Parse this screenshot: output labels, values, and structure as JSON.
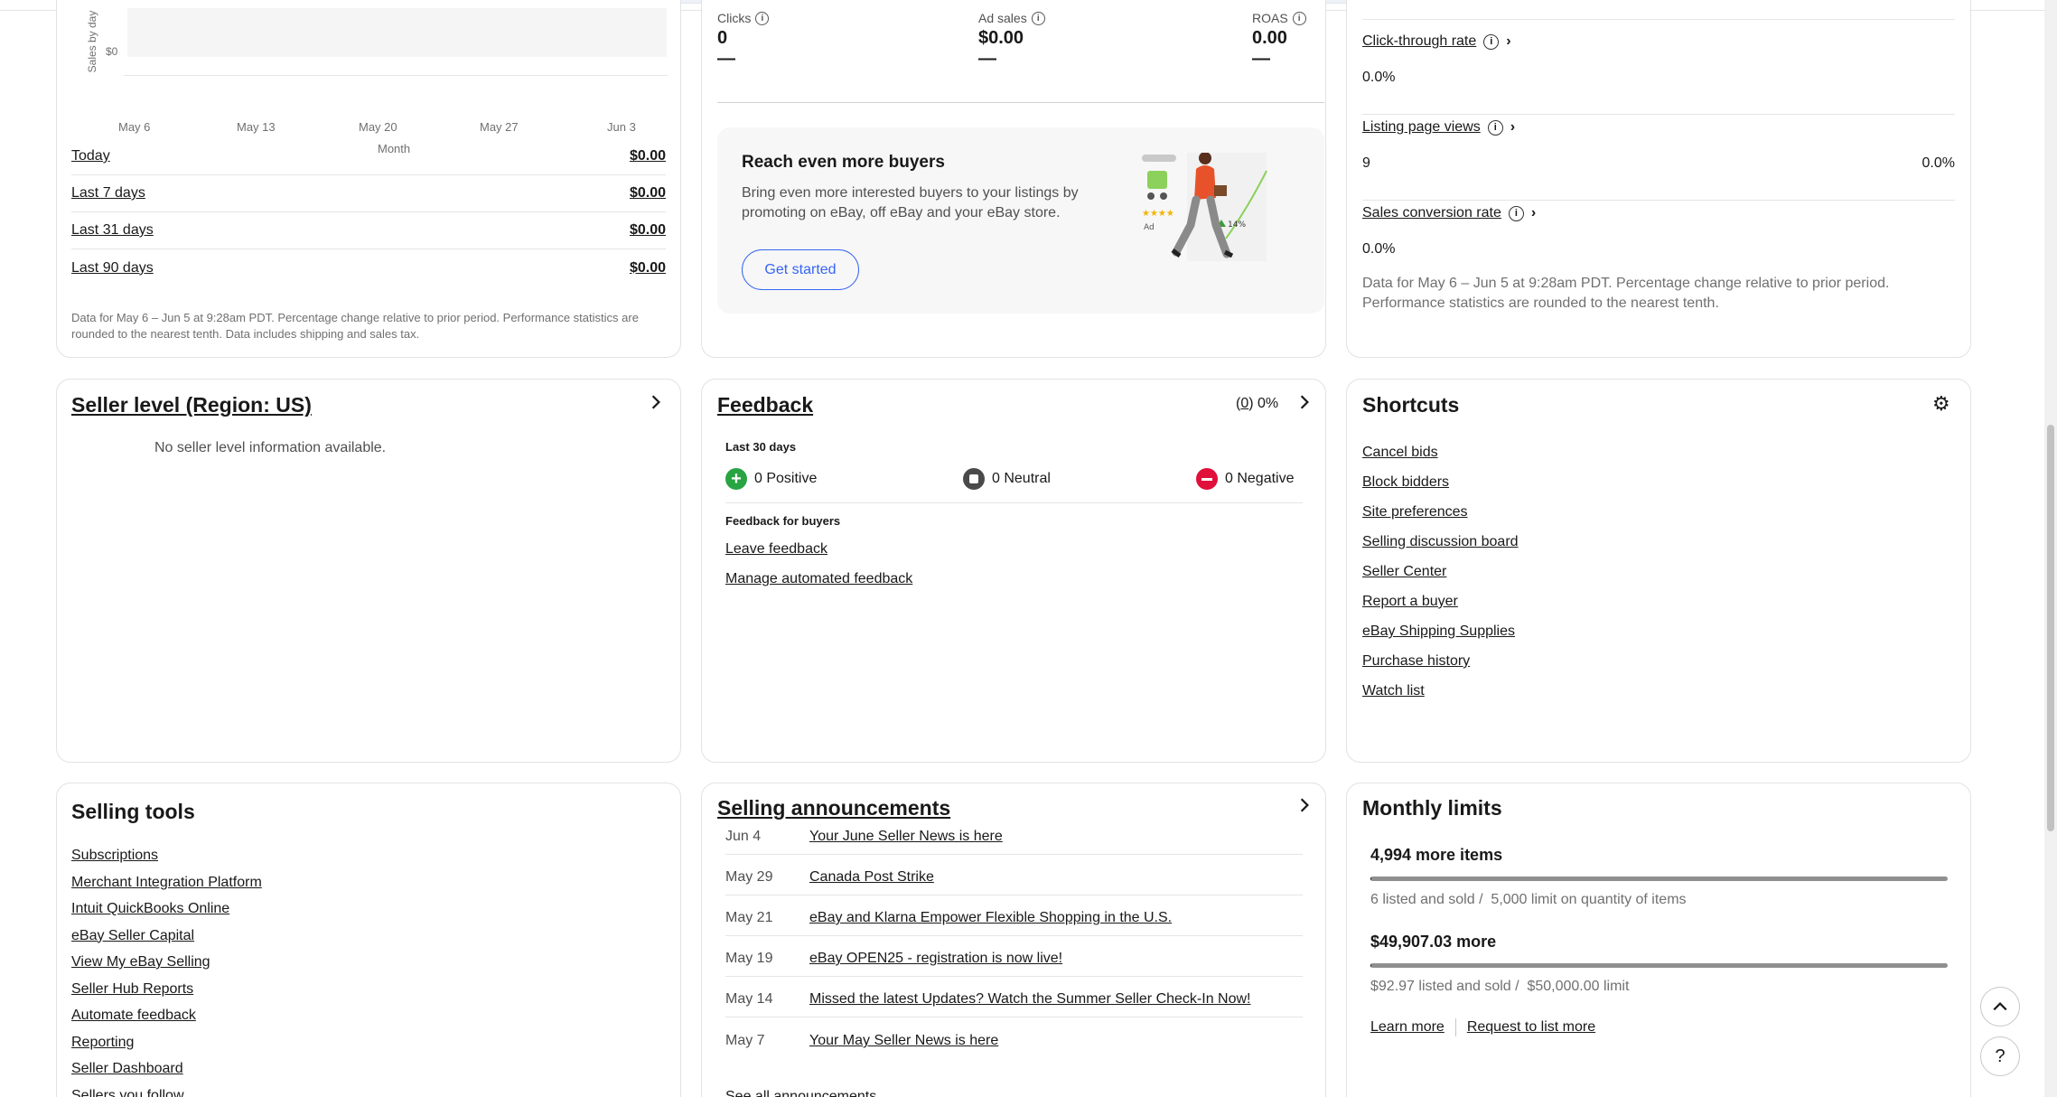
{
  "sales_card": {
    "y_axis_label": "Sales by day",
    "y_tick": "$0",
    "x_ticks": [
      "May 6",
      "May 13",
      "May 20",
      "May 27",
      "Jun 3"
    ],
    "x_axis_label": "Month",
    "rows": [
      {
        "label": "Today",
        "value": "$0.00"
      },
      {
        "label": "Last 7 days",
        "value": "$0.00"
      },
      {
        "label": "Last 31 days",
        "value": "$0.00"
      },
      {
        "label": "Last 90 days",
        "value": "$0.00"
      }
    ],
    "footnote": "Data for May 6 – Jun 5 at 9:28am PDT. Percentage change relative to prior period. Performance statistics are rounded to the nearest tenth. Data includes shipping and sales tax."
  },
  "ads_card": {
    "metrics": [
      {
        "label": "Clicks",
        "value": "0",
        "change": "—"
      },
      {
        "label": "Ad sales",
        "value": "$0.00",
        "change": "—"
      },
      {
        "label": "ROAS",
        "value": "0.00",
        "change": "—"
      }
    ],
    "promo_title": "Reach even more buyers",
    "promo_text": "Bring even more interested buyers to your listings by promoting on eBay, off eBay and your eBay store.",
    "promo_button": "Get started",
    "illus_ad": "Ad",
    "illus_pct": "14%"
  },
  "traffic_card": {
    "items": [
      {
        "label": "Click-through rate",
        "value": "0.0%",
        "change": ""
      },
      {
        "label": "Listing page views",
        "value": "9",
        "change": "0.0%"
      },
      {
        "label": "Sales conversion rate",
        "value": "0.0%",
        "change": ""
      }
    ],
    "footnote": "Data for May 6 – Jun 5 at 9:28am PDT. Percentage change relative to prior period. Performance statistics are rounded to the nearest tenth."
  },
  "seller_level": {
    "title": "Seller level (Region: US)",
    "empty": "No seller level information available."
  },
  "feedback": {
    "title": "Feedback",
    "count": "0",
    "percent": "0%",
    "period": "Last 30 days",
    "positive": "0 Positive",
    "neutral": "0 Neutral",
    "negative": "0 Negative",
    "buyers_heading": "Feedback for buyers",
    "leave": "Leave feedback",
    "manage": "Manage automated feedback"
  },
  "shortcuts": {
    "title": "Shortcuts",
    "links": [
      "Cancel bids",
      "Block bidders",
      "Site preferences",
      "Selling discussion board",
      "Seller Center",
      "Report a buyer",
      "eBay Shipping Supplies",
      "Purchase history",
      "Watch list"
    ]
  },
  "selling_tools": {
    "title": "Selling tools",
    "links": [
      "Subscriptions",
      "Merchant Integration Platform",
      "Intuit QuickBooks Online",
      "eBay Seller Capital",
      "View My eBay Selling",
      "Seller Hub Reports",
      "Automate feedback",
      "Reporting",
      "Seller Dashboard",
      "Sellers you follow"
    ]
  },
  "announcements": {
    "title": "Selling announcements",
    "items": [
      {
        "date": "Jun 4",
        "text": "Your June Seller News is here"
      },
      {
        "date": "May 29",
        "text": "Canada Post Strike"
      },
      {
        "date": "May 21",
        "text": "eBay and Klarna Empower Flexible Shopping in the U.S."
      },
      {
        "date": "May 19",
        "text": "eBay OPEN25 - registration is now live!"
      },
      {
        "date": "May 14",
        "text": "Missed the latest Updates? Watch the Summer Seller Check-In Now!"
      },
      {
        "date": "May 7",
        "text": "Your May Seller News is here"
      }
    ],
    "see_all": "See all announcements"
  },
  "monthly_limits": {
    "title": "Monthly limits",
    "items_headline": "4,994 more items",
    "items_used_fraction": 0.0012,
    "items_detail": "6 listed and sold /  5,000 limit on quantity of items",
    "amount_headline": "$49,907.03 more",
    "amount_used_fraction": 0.0019,
    "amount_detail": "$92.97 listed and sold /  $50,000.00 limit",
    "learn_more": "Learn more",
    "request": "Request to list more"
  },
  "float_buttons": {
    "top": "⌃",
    "help": "?"
  },
  "colors": {
    "positive": "#28a443",
    "neutral": "#4a4a4a",
    "negative": "#e0103a",
    "button_blue": "#3665f3",
    "promo_bg": "#f7f7f7"
  }
}
